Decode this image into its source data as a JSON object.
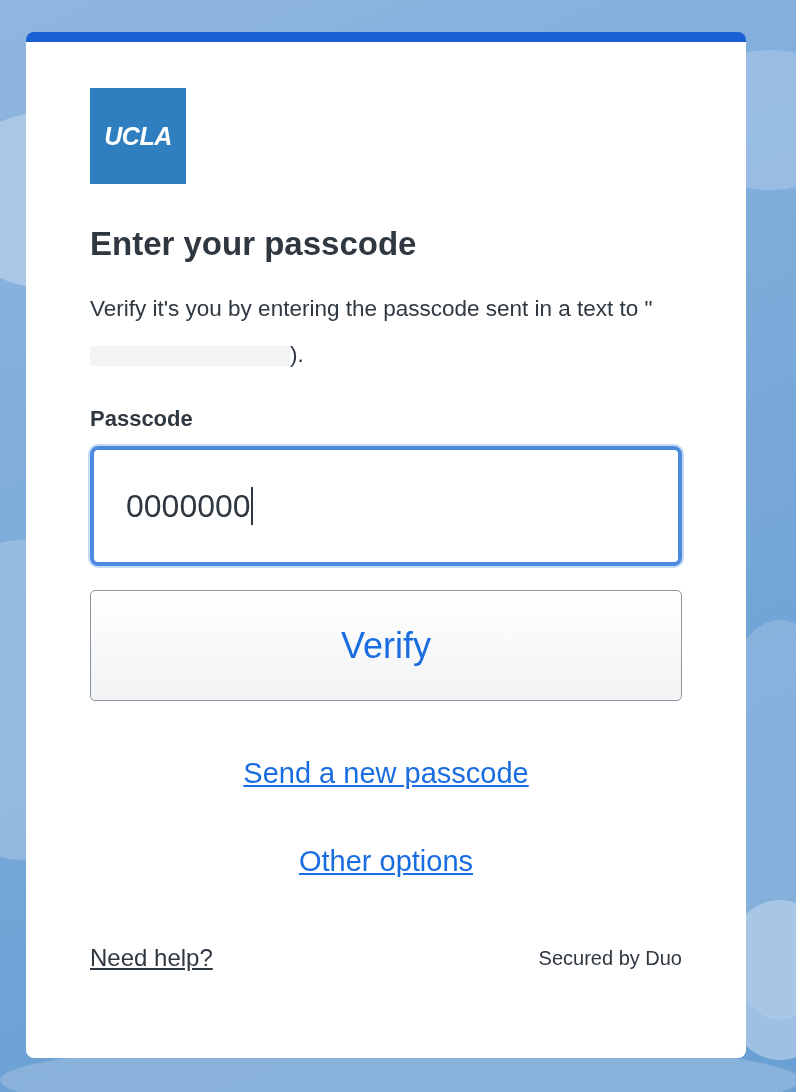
{
  "logo": {
    "text": "UCLA"
  },
  "title": "Enter your passcode",
  "description": {
    "text_before": "Verify it's you by entering the passcode sent in a text to \"",
    "redacted": true,
    "text_after": ")."
  },
  "passcode_field": {
    "label": "Passcode",
    "value": "0000000",
    "focused": true
  },
  "verify_button": {
    "label": "Verify"
  },
  "links": [
    {
      "label": "Send a new passcode"
    },
    {
      "label": "Other options"
    }
  ],
  "footer": {
    "help_link": "Need help?",
    "secured_by": "Secured by Duo"
  }
}
